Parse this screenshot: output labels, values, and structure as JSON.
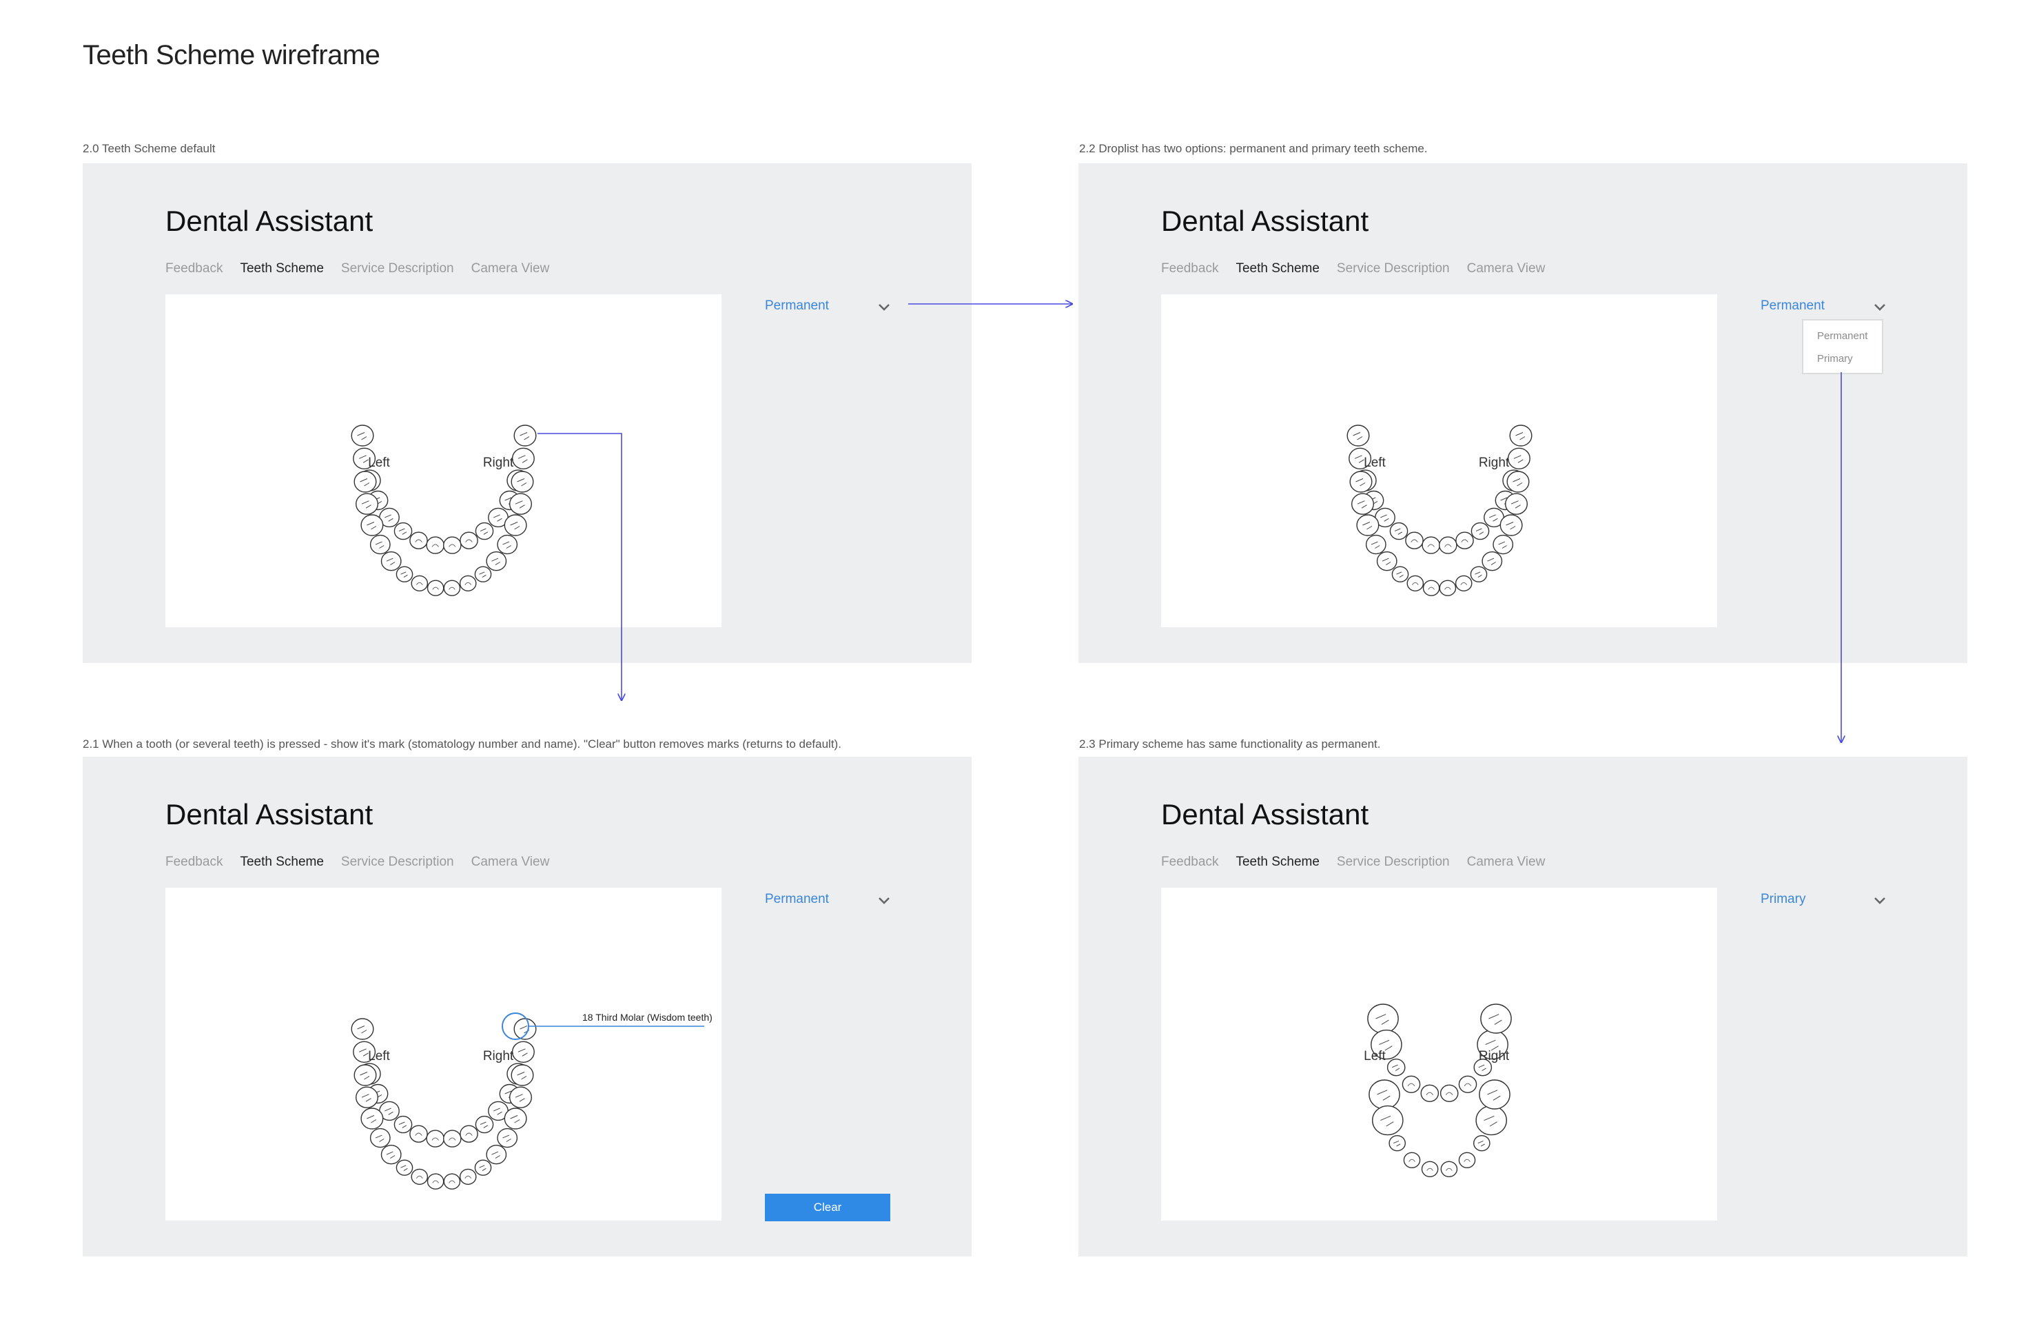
{
  "page": {
    "title": "Teeth Scheme wireframe"
  },
  "app": {
    "title": "Dental Assistant",
    "tabs": [
      "Feedback",
      "Teeth Scheme",
      "Service Description",
      "Camera View"
    ],
    "side_labels": {
      "left": "Left",
      "right": "Right"
    }
  },
  "frames": {
    "default": {
      "caption": "2.0 Teeth Scheme default",
      "select_value": "Permanent"
    },
    "droplist": {
      "caption": "2.2 Droplist has two options: permanent and primary teeth scheme.",
      "select_value": "Permanent",
      "options": [
        "Permanent",
        "Primary"
      ]
    },
    "pressed": {
      "caption": "2.1 When a tooth (or several teeth) is pressed - show it's mark (stomatology number and name). \"Clear\" button removes marks (returns to default).",
      "select_value": "Permanent",
      "tooth_mark": "18 Third Molar (Wisdom teeth)",
      "clear_label": "Clear"
    },
    "primary": {
      "caption": "2.3 Primary scheme has same functionality as permanent.",
      "select_value": "Primary"
    }
  },
  "colors": {
    "frame_bg": "#eceeef",
    "accent": "#3b86d8",
    "button": "#2f8ae6",
    "connector": "#4a4ae0"
  },
  "icons": {
    "dropdown": "chevron-down-icon"
  }
}
